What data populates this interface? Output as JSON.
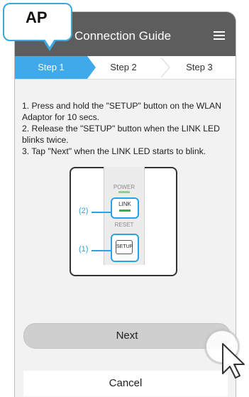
{
  "badge": {
    "text": "AP"
  },
  "header": {
    "title": "Connection Guide"
  },
  "steps": [
    {
      "label": "Step 1",
      "active": true
    },
    {
      "label": "Step 2",
      "active": false
    },
    {
      "label": "Step 3",
      "active": false
    }
  ],
  "instructions": [
    "1. Press and hold the \"SETUP\" button on the WLAN Adaptor for 10 secs.",
    "2. Release the \"SETUP\" button when the LINK LED blinks twice.",
    "3. Tap \"Next\" when the LINK LED starts to blink."
  ],
  "device": {
    "power_label": "POWER",
    "link_label": "LINK",
    "reset_label": "RESET",
    "setup_label": "SETUP",
    "callout_link": "(2)",
    "callout_setup": "(1)"
  },
  "buttons": {
    "next": "Next",
    "cancel": "Cancel"
  },
  "colors": {
    "accent": "#3fa9ea",
    "header": "#5d5d5d",
    "led_green": "#2db34a"
  }
}
